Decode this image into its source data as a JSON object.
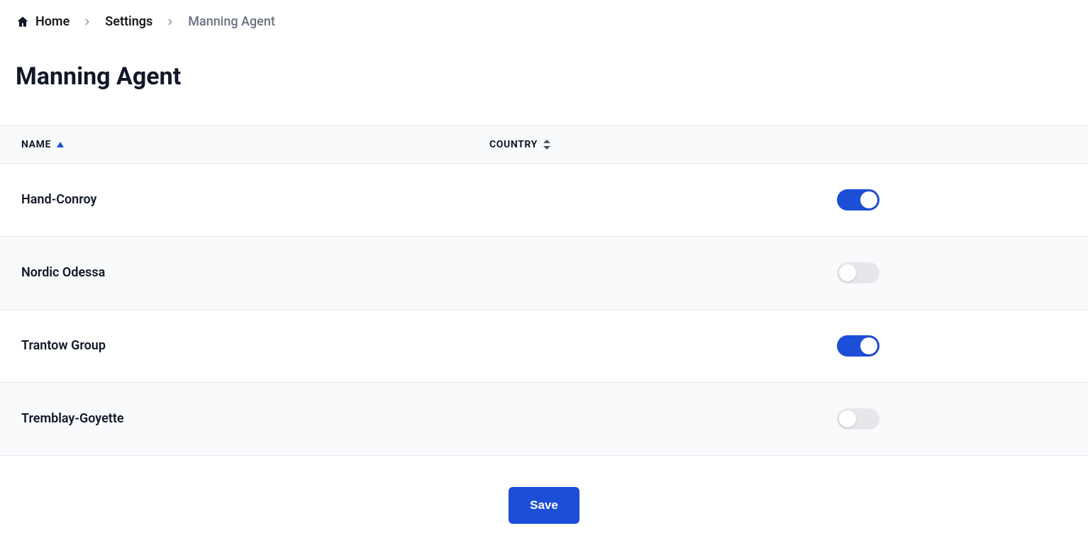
{
  "breadcrumb": {
    "home": "Home",
    "settings": "Settings",
    "current": "Manning Agent"
  },
  "page_title": "Manning Agent",
  "columns": {
    "name": "NAME",
    "country": "COUNTRY"
  },
  "rows": [
    {
      "name": "Hand-Conroy",
      "country": "",
      "enabled": true
    },
    {
      "name": "Nordic Odessa",
      "country": "",
      "enabled": false
    },
    {
      "name": "Trantow Group",
      "country": "",
      "enabled": true
    },
    {
      "name": "Tremblay-Goyette",
      "country": "",
      "enabled": false
    }
  ],
  "actions": {
    "save": "Save"
  }
}
